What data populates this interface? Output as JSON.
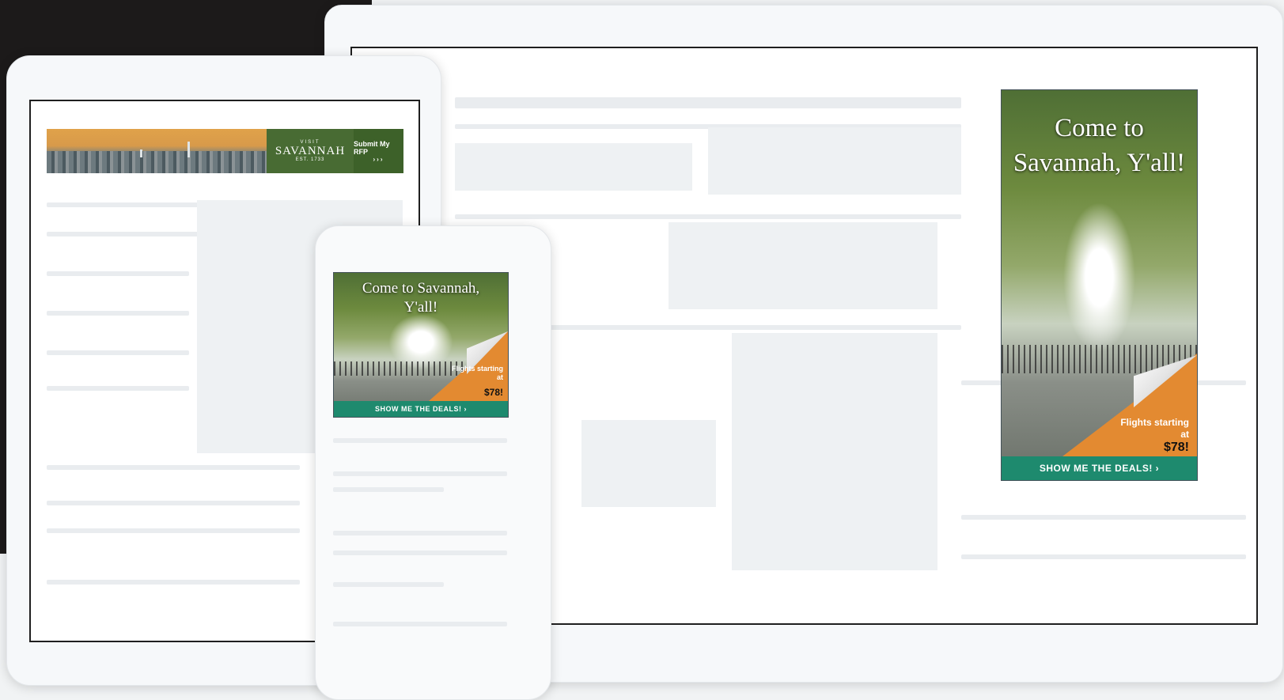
{
  "banner": {
    "logo_top": "VISIT",
    "logo_name": "SAVANNAH",
    "logo_est": "EST. 1733",
    "cta_label": "Submit My RFP",
    "cta_arrows": "›››"
  },
  "ad_small": {
    "headline": "Come to Savannah, Y'all!",
    "flights_label": "Flights starting at",
    "price": "$78!",
    "cta_label": "SHOW ME THE DEALS! ›"
  },
  "ad_large": {
    "headline": "Come to Savannah, Y'all!",
    "flights_label": "Flights starting at",
    "price": "$78!",
    "cta_label": "SHOW ME THE DEALS! ›"
  },
  "colors": {
    "brand_green": "#486b33",
    "cta_teal": "#1e8a6e",
    "promo_orange": "#e38a31"
  }
}
